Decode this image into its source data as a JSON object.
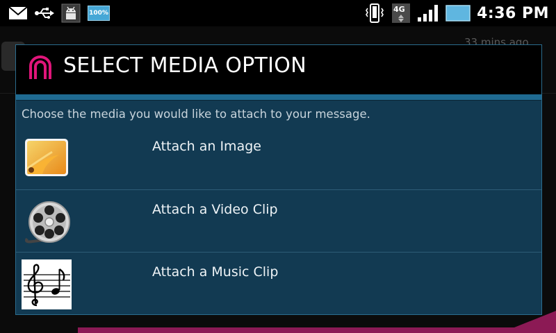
{
  "status_bar": {
    "left_icons": [
      "mail-icon",
      "usb-icon",
      "android-debug-icon",
      "battery-100-icon"
    ],
    "battery_label": "100%",
    "right_icons": [
      "vibrate-icon",
      "network-4g-icon",
      "signal-bars-icon",
      "battery-icon"
    ],
    "network_label": "4G",
    "time": "4:36 PM"
  },
  "background": {
    "timestamp": "33 mins ago"
  },
  "dialog": {
    "title": "SELECT MEDIA OPTION",
    "prompt": "Choose the media you would like to attach to your message.",
    "options": [
      {
        "label": "Attach an Image",
        "icon": "image-icon"
      },
      {
        "label": "Attach a Video Clip",
        "icon": "film-reel-icon"
      },
      {
        "label": "Attach a Music Clip",
        "icon": "music-note-icon"
      }
    ]
  },
  "colors": {
    "dialog_bg": "#123a52",
    "accent": "#1f6a91",
    "brand": "#e0157a"
  }
}
